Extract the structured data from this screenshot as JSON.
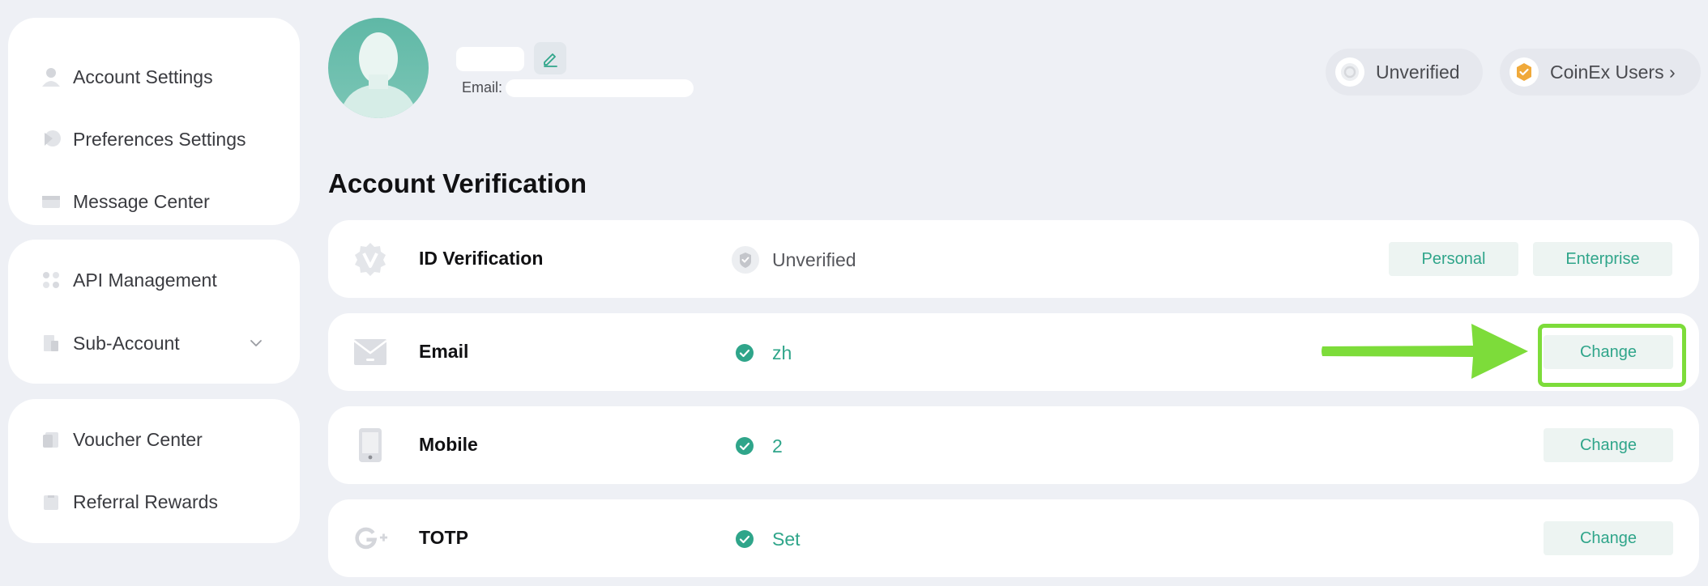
{
  "sidebar": {
    "group1": [
      {
        "label": "Account Settings",
        "icon": "user-icon"
      },
      {
        "label": "Preferences Settings",
        "icon": "preferences-icon"
      },
      {
        "label": "Message Center",
        "icon": "message-icon"
      }
    ],
    "group2": [
      {
        "label": "API Management",
        "icon": "api-icon"
      },
      {
        "label": "Sub-Account",
        "icon": "sub-account-icon",
        "expandable": true
      }
    ],
    "group3": [
      {
        "label": "Voucher Center",
        "icon": "voucher-icon"
      },
      {
        "label": "Referral Rewards",
        "icon": "referral-icon"
      }
    ]
  },
  "profile": {
    "email_label": "Email:",
    "badges": [
      {
        "label": "Unverified",
        "icon": "unverified-badge-icon"
      },
      {
        "label": "CoinEx Users",
        "icon": "coinex-user-badge-icon",
        "chevron": "›"
      }
    ]
  },
  "verification": {
    "title": "Account Verification",
    "rows": [
      {
        "name": "ID Verification",
        "status": "Unverified",
        "icon": "id-verification-icon",
        "actions": [
          "Personal",
          "Enterprise"
        ]
      },
      {
        "name": "Email",
        "status": "zh",
        "icon": "email-icon",
        "actions": [
          "Change"
        ]
      },
      {
        "name": "Mobile",
        "status": "2",
        "icon": "mobile-icon",
        "actions": [
          "Change"
        ]
      },
      {
        "name": "TOTP",
        "status": "Set",
        "icon": "google-icon",
        "actions": [
          "Change"
        ]
      }
    ]
  },
  "colors": {
    "accent": "#2fa58a",
    "background": "#eef0f5",
    "card": "#ffffff",
    "highlight": "#7ddc3a"
  }
}
